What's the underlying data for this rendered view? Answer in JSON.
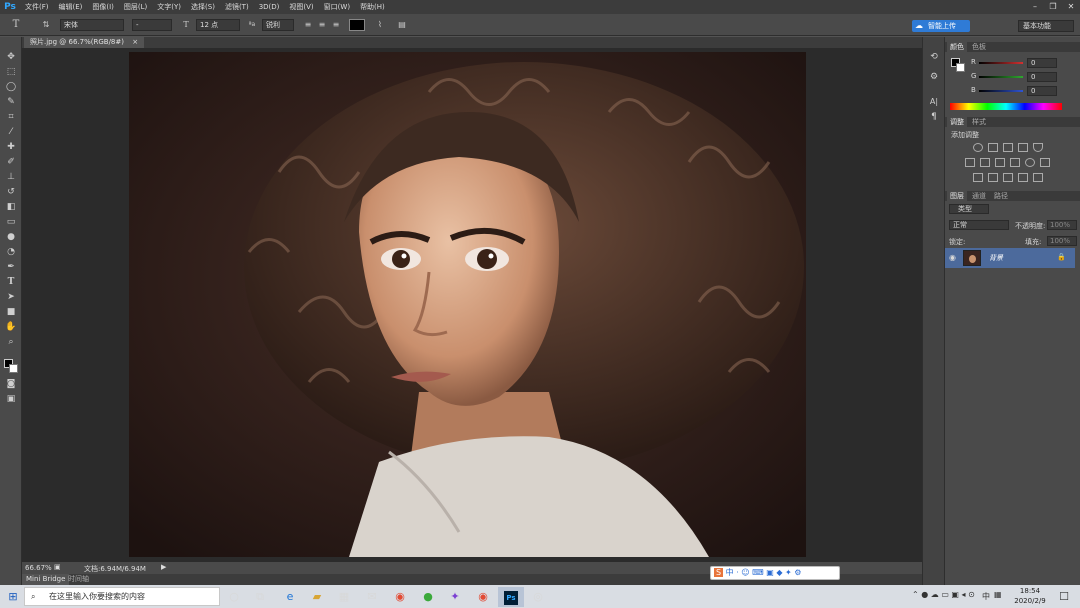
{
  "app": {
    "logo": "Ps"
  },
  "menu": [
    "文件(F)",
    "编辑(E)",
    "图像(I)",
    "图层(L)",
    "文字(Y)",
    "选择(S)",
    "滤镜(T)",
    "3D(D)",
    "视图(V)",
    "窗口(W)",
    "帮助(H)"
  ],
  "options": {
    "tool_glyph": "T",
    "font_family": "宋体",
    "font_style": "-",
    "font_size": "12 点",
    "aa_label": "ªa",
    "aa_mode": "锐利",
    "color_swatch": "#000000",
    "cloud_upload": "智能上传",
    "workspace": "基本功能"
  },
  "document": {
    "tab_title": "照片.jpg @ 66.7%(RGB/8#)",
    "zoom": "66.67%",
    "doc_size": "文档:6.94M/6.94M"
  },
  "bridge": {
    "mini_bridge": "Mini Bridge",
    "timeline": "时间轴"
  },
  "color_panel": {
    "tabs": [
      "颜色",
      "色板"
    ],
    "channels": [
      {
        "label": "R",
        "value": "0",
        "color": "#d23030"
      },
      {
        "label": "G",
        "value": "0",
        "color": "#2fa82f"
      },
      {
        "label": "B",
        "value": "0",
        "color": "#2f54d2"
      }
    ]
  },
  "adjustments_panel": {
    "tabs": [
      "调整",
      "样式"
    ],
    "title": "添加调整"
  },
  "layers_panel": {
    "tabs": [
      "图层",
      "通道",
      "路径"
    ],
    "kind_filter": "类型",
    "blend_mode": "正常",
    "opacity_label": "不透明度:",
    "opacity_value": "100%",
    "lock_label": "锁定:",
    "fill_label": "填充:",
    "fill_value": "100%",
    "layer_name": "背景"
  },
  "taskbar": {
    "search_placeholder": "在这里输入你要搜索的内容",
    "ps_label": "Ps",
    "time": "18:54",
    "date": "2020/2/9",
    "ime_label": "中",
    "lang": "中"
  }
}
